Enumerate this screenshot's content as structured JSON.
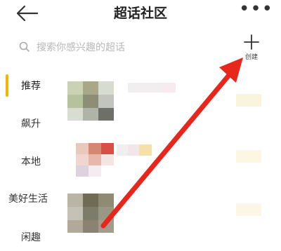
{
  "header": {
    "title": "超话社区",
    "back_icon": "back-arrow-icon",
    "more_icon": "more-dots-icon",
    "more_glyph": "•••"
  },
  "search": {
    "placeholder": "搜索你感兴趣的超话",
    "icon": "search-icon"
  },
  "create": {
    "label": "创建",
    "icon": "plus-icon"
  },
  "sidebar": {
    "items": [
      {
        "label": "推荐",
        "active": true
      },
      {
        "label": "飙升",
        "active": false
      },
      {
        "label": "本地",
        "active": false
      },
      {
        "label": "美好生活",
        "active": false
      },
      {
        "label": "闲趣",
        "active": false
      }
    ]
  },
  "colors": {
    "accent": "#f5b400",
    "annotation_arrow": "#e8261c",
    "text_primary": "#222222",
    "placeholder": "#b8b8b8"
  }
}
